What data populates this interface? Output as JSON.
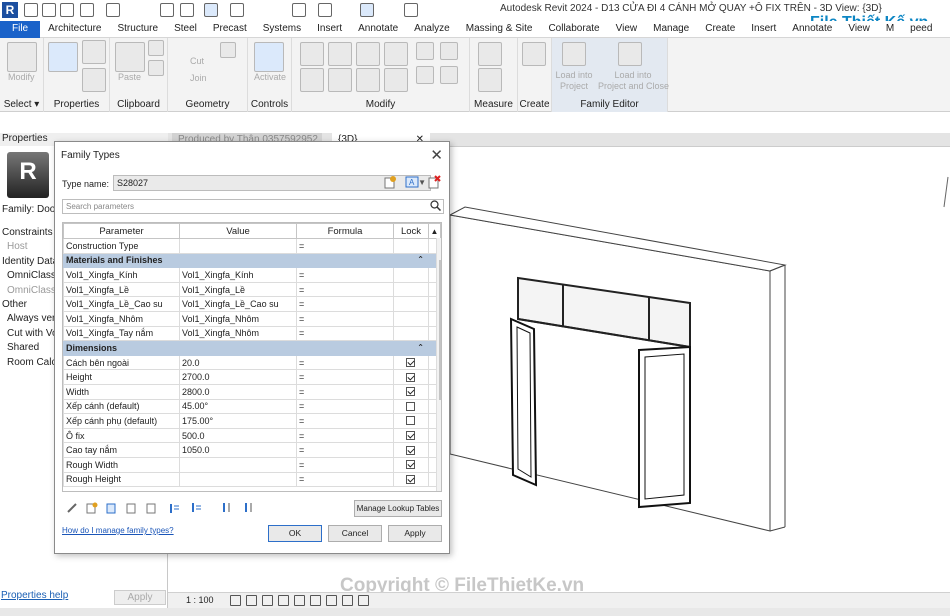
{
  "window": {
    "title": "Autodesk Revit 2024 - D13 CỬA ĐI 4 CÁNH MỞ QUAY +Ô FIX TRÊN - 3D View: {3D}",
    "app_letter": "R"
  },
  "watermark": {
    "logo": "File Thiết Kế.vn",
    "copyright": "Copyright © FileThietKe.vn"
  },
  "ribbon_tabs": [
    "File",
    "Architecture",
    "Structure",
    "Steel",
    "Precast",
    "Systems",
    "Insert",
    "Annotate",
    "Analyze",
    "Massing & Site",
    "Collaborate",
    "View",
    "Manage",
    "Create",
    "Insert",
    "Annotate",
    "View",
    "M",
    "peed"
  ],
  "ribbon_groups": {
    "select": "Select",
    "properties": "Properties",
    "clipboard": "Clipboard",
    "geometry": "Geometry",
    "controls": "Controls",
    "modify": "Modify",
    "measure": "Measure",
    "create": "Create",
    "family_editor": "Family Editor"
  },
  "ribbon_text": {
    "modify": "Modify",
    "paste": "Paste",
    "cut": "Cut",
    "join": "Join",
    "activate": "Activate",
    "load_project": "Load into\nProject",
    "load_close": "Load into\nProject and Close"
  },
  "properties_palette": {
    "header": "Properties",
    "family": "Family: Door",
    "lines": [
      "Constraints",
      "Host",
      "Identity Data",
      "OmniClass N",
      "OmniClass T",
      "Other",
      "Always vert",
      "Cut with Vo",
      "Shared",
      "Room Calcu"
    ],
    "help": "Properties help",
    "apply": "Apply"
  },
  "view_tabs": [
    "Produced by Thân 0357592952",
    "{3D}"
  ],
  "statusbar": {
    "scale": "1 : 100"
  },
  "dialog": {
    "title": "Family Types",
    "type_name_label": "Type name:",
    "type_name_value": "S28027",
    "search_placeholder": "Search parameters",
    "columns": [
      "Parameter",
      "Value",
      "Formula",
      "Lock"
    ],
    "rows": [
      {
        "kind": "param",
        "parameter": "Construction Type",
        "value": "",
        "formula": "=",
        "lock": null
      },
      {
        "kind": "group",
        "parameter": "Materials and Finishes"
      },
      {
        "kind": "param",
        "parameter": "Vol1_Xingfa_Kính",
        "value": "Vol1_Xingfa_Kính",
        "formula": "=",
        "lock": null
      },
      {
        "kind": "param",
        "parameter": "Vol1_Xingfa_Lề",
        "value": "Vol1_Xingfa_Lề",
        "formula": "=",
        "lock": null
      },
      {
        "kind": "param",
        "parameter": "Vol1_Xingfa_Lề_Cao su",
        "value": "Vol1_Xingfa_Lề_Cao su",
        "formula": "=",
        "lock": null
      },
      {
        "kind": "param",
        "parameter": "Vol1_Xingfa_Nhôm",
        "value": "Vol1_Xingfa_Nhôm",
        "formula": "=",
        "lock": null
      },
      {
        "kind": "param",
        "parameter": "Vol1_Xingfa_Tay nắm",
        "value": "Vol1_Xingfa_Nhôm",
        "formula": "=",
        "lock": null
      },
      {
        "kind": "group",
        "parameter": "Dimensions"
      },
      {
        "kind": "param",
        "parameter": "Cách bên ngoài",
        "value": "20.0",
        "formula": "=",
        "lock": true
      },
      {
        "kind": "param",
        "parameter": "Height",
        "value": "2700.0",
        "formula": "=",
        "lock": true
      },
      {
        "kind": "param",
        "parameter": "Width",
        "value": "2800.0",
        "formula": "=",
        "lock": true
      },
      {
        "kind": "param",
        "parameter": "Xếp cánh (default)",
        "value": "45.00°",
        "formula": "=",
        "lock": false
      },
      {
        "kind": "param",
        "parameter": "Xếp cánh phụ (default)",
        "value": "175.00°",
        "formula": "=",
        "lock": false
      },
      {
        "kind": "param",
        "parameter": "Ô fix",
        "value": "500.0",
        "formula": "=",
        "lock": true
      },
      {
        "kind": "param",
        "parameter": "Cao tay nắm",
        "value": "1050.0",
        "formula": "=",
        "lock": true
      },
      {
        "kind": "param",
        "parameter": "Rough Width",
        "value": "",
        "formula": "=",
        "lock": true
      },
      {
        "kind": "param",
        "parameter": "Rough Height",
        "value": "",
        "formula": "=",
        "lock": true
      }
    ],
    "manage_lookup": "Manage Lookup Tables",
    "help_link": "How do I manage family types?",
    "ok": "OK",
    "cancel": "Cancel",
    "apply": "Apply"
  }
}
